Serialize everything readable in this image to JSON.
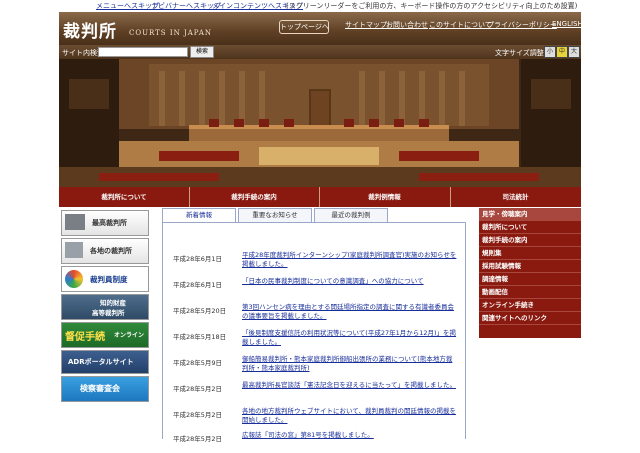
{
  "skip_links": {
    "menu": "メニューへスキップ",
    "banner": "ナビバナーへスキップ",
    "content": "メインコンテンツへスキップ",
    "note": "(スクリーンリーダーをご利用の方、キーボード操作の方のアクセシビリティ向上のため設置)"
  },
  "header": {
    "logo_kanji": "裁判所",
    "logo_en": "COURTS IN JAPAN",
    "top_links": [
      "トップページへ",
      "サイトマップ",
      "お問い合わせ",
      "このサイトについて",
      "プライバシーポリシー",
      "ENGLISH"
    ]
  },
  "search": {
    "label": "サイト内検索",
    "button": "検索",
    "font_size_label": "文字サイズ調整",
    "font_sizes": [
      "小",
      "中",
      "大"
    ]
  },
  "nav": [
    "裁判所について",
    "裁判手続の案内",
    "裁判例情報",
    "司法統計"
  ],
  "banners": [
    {
      "label": "最高裁判所",
      "icon": "supreme-court-icon"
    },
    {
      "label": "各地の裁判所",
      "icon": "map-icon"
    },
    {
      "label": "裁判員制度",
      "icon": "saibanin-logo-icon"
    },
    {
      "label": "知的財産高等裁判所",
      "line1": "知的財産",
      "line2": "高等裁判所"
    },
    {
      "label": "督促手続オンラインシステム",
      "line1": "督促手続",
      "line2": "オンライン"
    },
    {
      "label": "ADRポータルサイト"
    },
    {
      "label": "検察審査会"
    }
  ],
  "tabs": [
    "新着情報",
    "重要なお知らせ",
    "最近の裁判例"
  ],
  "news": [
    {
      "date": "平成28年6月1日",
      "text": "平成28年度裁判所インターンシップ(家庭裁判所調査官)実施のお知らせを掲載しました。"
    },
    {
      "date": "平成28年6月1日",
      "text": "「日本の民事裁判制度についての意識調査」への協力について"
    },
    {
      "date": "平成28年5月20日",
      "text": "第3回ハンセン病を理由とする開廷場所指定の調査に関する有識者委員会の議事要旨を掲載しました。"
    },
    {
      "date": "平成28年5月18日",
      "text": "「後見制度支援信託の利用状況等について(平成27年1月から12月)」を掲載しました。"
    },
    {
      "date": "平成28年5月9日",
      "text": "御船簡易裁判所・熊本家庭裁判所御船出張所の業務について(熊本地方裁判所・熊本家庭裁判所)"
    },
    {
      "date": "平成28年5月2日",
      "text": "最高裁判所長官談話「憲法記念日を迎えるに当たって」を掲載しました。"
    },
    {
      "date": "平成28年5月2日",
      "text": "各地の地方裁判所ウェブサイトにおいて、裁判員裁判の開廷情報の掲載を開始しました。"
    },
    {
      "date": "平成28年5月2日",
      "text": "広報誌「司法の窓」第81号を掲載しました。"
    }
  ],
  "side_menu": [
    "見学・傍聴案内",
    "裁判所について",
    "裁判手続の案内",
    "規則集",
    "採用試験情報",
    "調達情報",
    "動画配信",
    "オンライン手続き",
    "関連サイトへのリンク"
  ],
  "colors": {
    "nav_bg": "#8a1a10",
    "header_bg": "#5e3f24",
    "link": "#1a2f9a"
  }
}
